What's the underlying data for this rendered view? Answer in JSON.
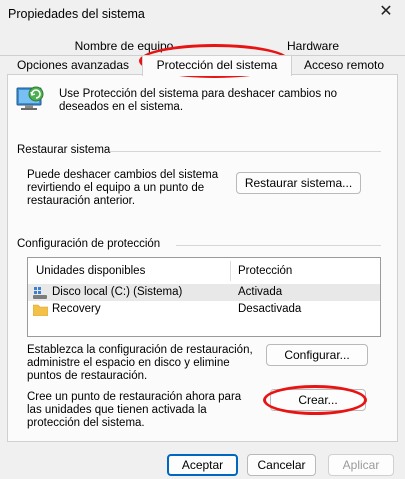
{
  "window": {
    "title": "Propiedades del sistema"
  },
  "tabs": {
    "nombre_equipo": "Nombre de equipo",
    "hardware": "Hardware",
    "opciones_avanzadas": "Opciones avanzadas",
    "proteccion_sistema": "Protección del sistema",
    "acceso_remoto": "Acceso remoto"
  },
  "intro_text": "Use Protección del sistema para deshacer cambios no deseados en el sistema.",
  "restore": {
    "heading": "Restaurar sistema",
    "description": "Puede deshacer cambios del sistema revirtiendo el equipo a un punto de restauración anterior.",
    "button": "Restaurar sistema..."
  },
  "protection": {
    "heading": "Configuración de protección",
    "columns": [
      "Unidades disponibles",
      "Protección"
    ],
    "rows": [
      {
        "drive": "Disco local (C:) (Sistema)",
        "status": "Activada"
      },
      {
        "drive": "Recovery",
        "status": "Desactivada"
      }
    ],
    "configure_text": "Establezca la configuración de restauración, administre el espacio en disco y elimine puntos de restauración.",
    "configure_button": "Configurar...",
    "create_text": "Cree un punto de restauración ahora para las unidades que tienen activada la protección del sistema.",
    "create_button": "Crear..."
  },
  "footer": {
    "accept": "Aceptar",
    "cancel": "Cancelar",
    "apply": "Aplicar"
  },
  "colors": {
    "highlight": "#e81414",
    "accept_border": "#0067c0",
    "selected_row": "#e8e8e8"
  },
  "icons": [
    "close-icon",
    "system-protection-icon",
    "system-drive-icon",
    "folder-icon"
  ]
}
